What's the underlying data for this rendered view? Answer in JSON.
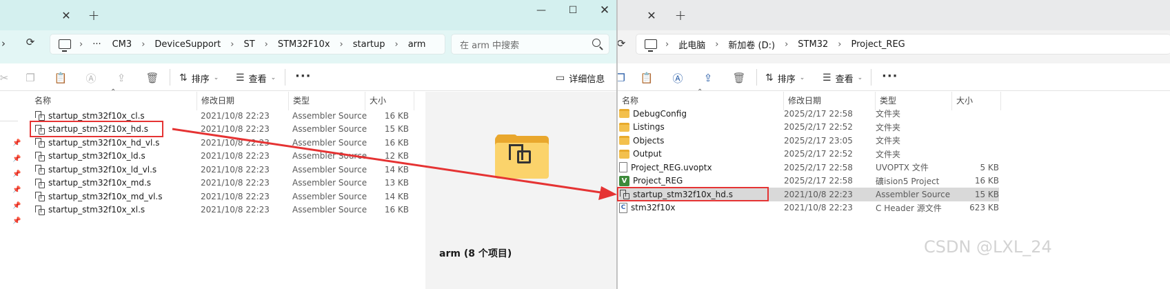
{
  "left_window": {
    "toolbar": {
      "sort_label": "排序",
      "view_label": "查看",
      "details_label": "详细信息"
    },
    "address": [
      "CM3",
      "DeviceSupport",
      "ST",
      "STM32F10x",
      "startup",
      "arm"
    ],
    "address_more": "···",
    "search_placeholder": "在 arm 中搜索",
    "columns": {
      "name": "名称",
      "date": "修改日期",
      "type": "类型",
      "size": "大小"
    },
    "files": [
      {
        "name": "startup_stm32f10x_cl.s",
        "date": "2021/10/8 22:23",
        "type": "Assembler Source",
        "size": "16 KB"
      },
      {
        "name": "startup_stm32f10x_hd.s",
        "date": "2021/10/8 22:23",
        "type": "Assembler Source",
        "size": "15 KB"
      },
      {
        "name": "startup_stm32f10x_hd_vl.s",
        "date": "2021/10/8 22:23",
        "type": "Assembler Source",
        "size": "16 KB"
      },
      {
        "name": "startup_stm32f10x_ld.s",
        "date": "2021/10/8 22:23",
        "type": "Assembler Source",
        "size": "12 KB"
      },
      {
        "name": "startup_stm32f10x_ld_vl.s",
        "date": "2021/10/8 22:23",
        "type": "Assembler Source",
        "size": "14 KB"
      },
      {
        "name": "startup_stm32f10x_md.s",
        "date": "2021/10/8 22:23",
        "type": "Assembler Source",
        "size": "13 KB"
      },
      {
        "name": "startup_stm32f10x_md_vl.s",
        "date": "2021/10/8 22:23",
        "type": "Assembler Source",
        "size": "14 KB"
      },
      {
        "name": "startup_stm32f10x_xl.s",
        "date": "2021/10/8 22:23",
        "type": "Assembler Source",
        "size": "16 KB"
      }
    ],
    "preview_title": "arm (8 个项目)"
  },
  "right_window": {
    "toolbar": {
      "sort_label": "排序",
      "view_label": "查看"
    },
    "address": [
      "此电脑",
      "新加卷 (D:)",
      "STM32",
      "Project_REG"
    ],
    "columns": {
      "name": "名称",
      "date": "修改日期",
      "type": "类型",
      "size": "大小"
    },
    "files": [
      {
        "name": "DebugConfig",
        "date": "2025/2/17 22:58",
        "type": "文件夹",
        "size": "",
        "icon": "folder-icon"
      },
      {
        "name": "Listings",
        "date": "2025/2/17 22:52",
        "type": "文件夹",
        "size": "",
        "icon": "folder-icon"
      },
      {
        "name": "Objects",
        "date": "2025/2/17 23:05",
        "type": "文件夹",
        "size": "",
        "icon": "folder-icon"
      },
      {
        "name": "Output",
        "date": "2025/2/17 22:52",
        "type": "文件夹",
        "size": "",
        "icon": "folder-icon"
      },
      {
        "name": "Project_REG.uvoptx",
        "date": "2025/2/17 22:58",
        "type": "UVOPTX 文件",
        "size": "5 KB",
        "icon": "document-icon"
      },
      {
        "name": "Project_REG",
        "date": "2025/2/17 22:58",
        "type": "礦ision5 Project",
        "size": "16 KB",
        "icon": "keil-project-icon"
      },
      {
        "name": "startup_stm32f10x_hd.s",
        "date": "2021/10/8 22:23",
        "type": "Assembler Source",
        "size": "15 KB",
        "icon": "assembler-file-icon",
        "selected": true
      },
      {
        "name": "stm32f10x",
        "date": "2021/10/8 22:23",
        "type": "C Header 源文件",
        "size": "623 KB",
        "icon": "c-header-icon"
      }
    ]
  },
  "annotation": {
    "color": "#e53333"
  },
  "watermark": "CSDN @LXL_24"
}
